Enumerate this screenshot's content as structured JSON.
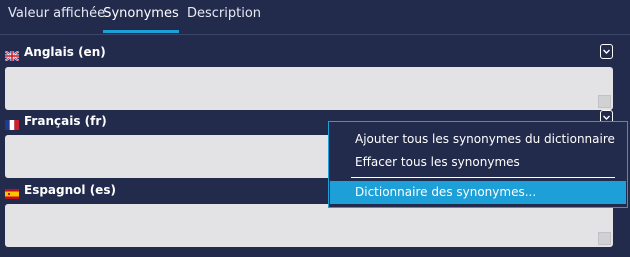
{
  "tabs": [
    {
      "label": "Valeur affichée"
    },
    {
      "label": "Synonymes"
    },
    {
      "label": "Description"
    }
  ],
  "sections": [
    {
      "label": "Anglais (en)",
      "flag": "uk-flag-icon"
    },
    {
      "label": "Français (fr)",
      "flag": "france-flag-icon"
    },
    {
      "label": "Espagnol (es)",
      "flag": "spain-flag-icon"
    }
  ],
  "context_menu": {
    "items": [
      {
        "label": "Ajouter tous les synonymes du dictionnaire"
      },
      {
        "label": "Effacer tous les synonymes"
      },
      {
        "label": "Dictionnaire des synonymes..."
      }
    ]
  },
  "colors": {
    "background": "#232b4d",
    "accent": "#1d9fd8",
    "field": "#e3e3e5"
  }
}
